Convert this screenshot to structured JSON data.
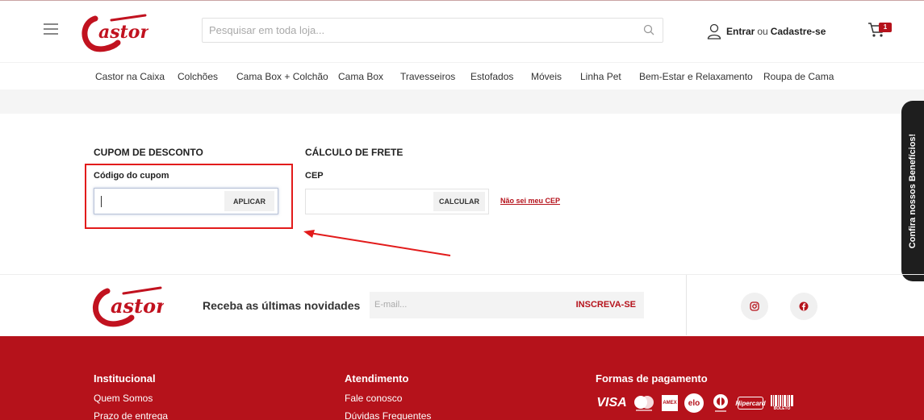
{
  "header": {
    "logo_text": "Castor",
    "search_placeholder": "Pesquisar em toda loja...",
    "login_label": "Entrar",
    "or_label": "ou",
    "register_label": "Cadastre-se",
    "cart_count": "1"
  },
  "nav": {
    "items": [
      "Castor na Caixa",
      "Colchões",
      "Cama Box + Colchão",
      "Cama Box",
      "Travesseiros",
      "Estofados",
      "Móveis",
      "Linha Pet",
      "Bem-Estar e Relaxamento",
      "Roupa de Cama"
    ]
  },
  "coupon": {
    "title": "CUPOM DE DESCONTO",
    "field_label": "Código do cupom",
    "value": "",
    "apply_label": "APLICAR"
  },
  "freight": {
    "title": "CÁLCULO DE FRETE",
    "field_label": "CEP",
    "value": "",
    "calc_label": "CALCULAR",
    "unknown_cep_link": "Não sei meu CEP"
  },
  "side_tab": {
    "label": "Confira nossos Benefícios!"
  },
  "newsletter": {
    "logo_text": "Castor",
    "text": "Receba as últimas novidades",
    "email_placeholder": "E-mail...",
    "subscribe_label": "INSCREVA-SE"
  },
  "social": {
    "icons": [
      "instagram-icon",
      "facebook-icon"
    ]
  },
  "footer": {
    "institucional": {
      "title": "Institucional",
      "links": [
        "Quem Somos",
        "Prazo de entrega"
      ]
    },
    "atendimento": {
      "title": "Atendimento",
      "links": [
        "Fale conosco",
        "Dúvidas Frequentes"
      ]
    },
    "pagamento": {
      "title": "Formas de pagamento",
      "methods": [
        "VISA",
        "AMEX",
        "elo",
        "Hipercard",
        "BOLETO"
      ]
    }
  },
  "colors": {
    "brand_red": "#b5121b",
    "highlight_red": "#e21b1b"
  }
}
